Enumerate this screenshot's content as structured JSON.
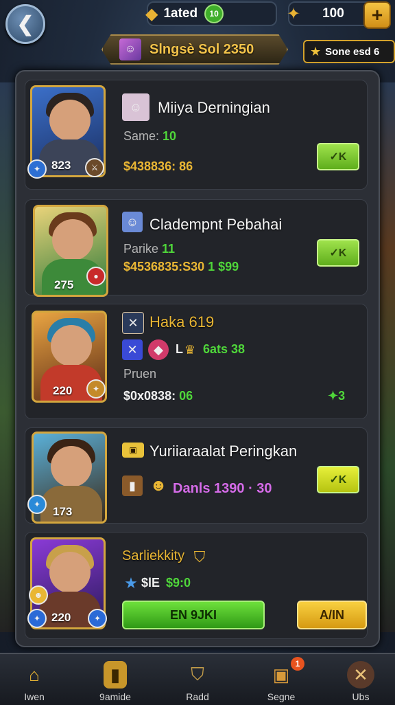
{
  "header": {
    "back_icon": "back-arrow-icon",
    "resource1": {
      "icon": "gold-bars-icon",
      "label": "1ated",
      "badge": "10"
    },
    "resource2": {
      "icon": "ticket-icon",
      "value": "100",
      "plus": "+"
    },
    "banner": {
      "text": "Slngsè Sol 2350"
    },
    "side_badge": {
      "text": "Sone esd 6"
    }
  },
  "panel": {
    "close": "✕",
    "cards": [
      {
        "name": "Miiya Derningian",
        "level": "823",
        "line1": {
          "label": "Same: ",
          "value": "10"
        },
        "line2": "$438836: 86",
        "button": "✓K"
      },
      {
        "name": "Cladempnt Pebahai",
        "level": "275",
        "line1": {
          "label": "Parike ",
          "value": "11"
        },
        "line2": {
          "gold": "$4536835:S30",
          "green": "1 $99"
        },
        "button": "✓K"
      },
      {
        "name": "Haka 619",
        "level": "220",
        "stats": {
          "l": "L",
          "value": "6ats 38"
        },
        "line1": "Pruen",
        "line2": {
          "white": "$0x0838:",
          "green": "06"
        },
        "right": "✦3"
      },
      {
        "name": "Yuriiaraalat Peringkan",
        "level": "173",
        "line1": {
          "text": "Danls 1390 · 30"
        },
        "button": "✓K"
      },
      {
        "name": "Sarliekkity",
        "level": "220",
        "line1": {
          "prefix": "$lE",
          "value": "$9:0"
        },
        "primary_button": "EN 9JKI",
        "secondary_button": "A/IN"
      }
    ]
  },
  "nav": [
    {
      "icon": "house-icon",
      "label": "Iwen"
    },
    {
      "icon": "card-icon",
      "label": "9amide"
    },
    {
      "icon": "shield-icon",
      "label": "Radd"
    },
    {
      "icon": "chest-icon",
      "label": "Segne",
      "notif": "1"
    },
    {
      "icon": "crossed-swords-icon",
      "label": "Ubs"
    }
  ]
}
